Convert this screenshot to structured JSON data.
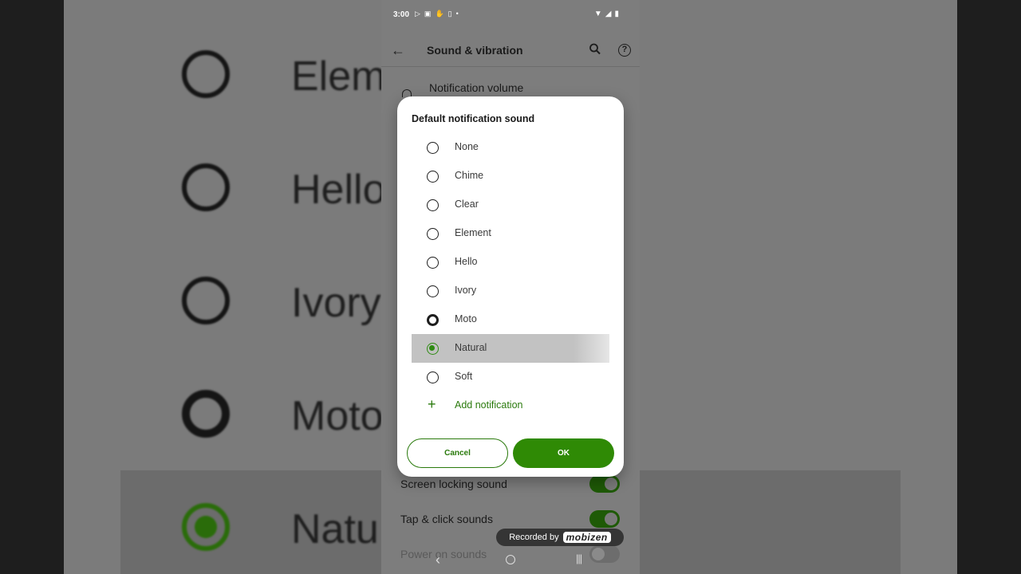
{
  "background": {
    "zoom_labels": [
      "Elem",
      "Hello",
      "Ivory",
      "Moto",
      "Natu"
    ]
  },
  "statusbar": {
    "time": "3:00",
    "icons": [
      "play-icon",
      "photo-icon",
      "hand-icon",
      "screen-record-icon",
      "dot-icon"
    ],
    "right_icons": [
      "wifi-icon",
      "signal-icon",
      "battery-icon"
    ]
  },
  "appbar": {
    "title": "Sound & vibration"
  },
  "settings": {
    "notification_volume": "Notification volume",
    "screen_locking_sound": "Screen locking sound",
    "tap_click_sounds": "Tap & click sounds",
    "power_on_sounds": "Power on sounds"
  },
  "dialog": {
    "title": "Default notification sound",
    "options": [
      {
        "label": "None"
      },
      {
        "label": "Chime"
      },
      {
        "label": "Clear"
      },
      {
        "label": "Element"
      },
      {
        "label": "Hello"
      },
      {
        "label": "Ivory"
      },
      {
        "label": "Moto"
      },
      {
        "label": "Natural"
      },
      {
        "label": "Soft"
      }
    ],
    "selected": "Natural",
    "add_label": "Add notification",
    "cancel_label": "Cancel",
    "ok_label": "OK"
  },
  "watermark": {
    "prefix": "Recorded by",
    "brand": "mobizen"
  },
  "colors": {
    "accent": "#2f8a05",
    "accent_text": "#2a7a0c",
    "scrim": "#7d7d7d"
  }
}
